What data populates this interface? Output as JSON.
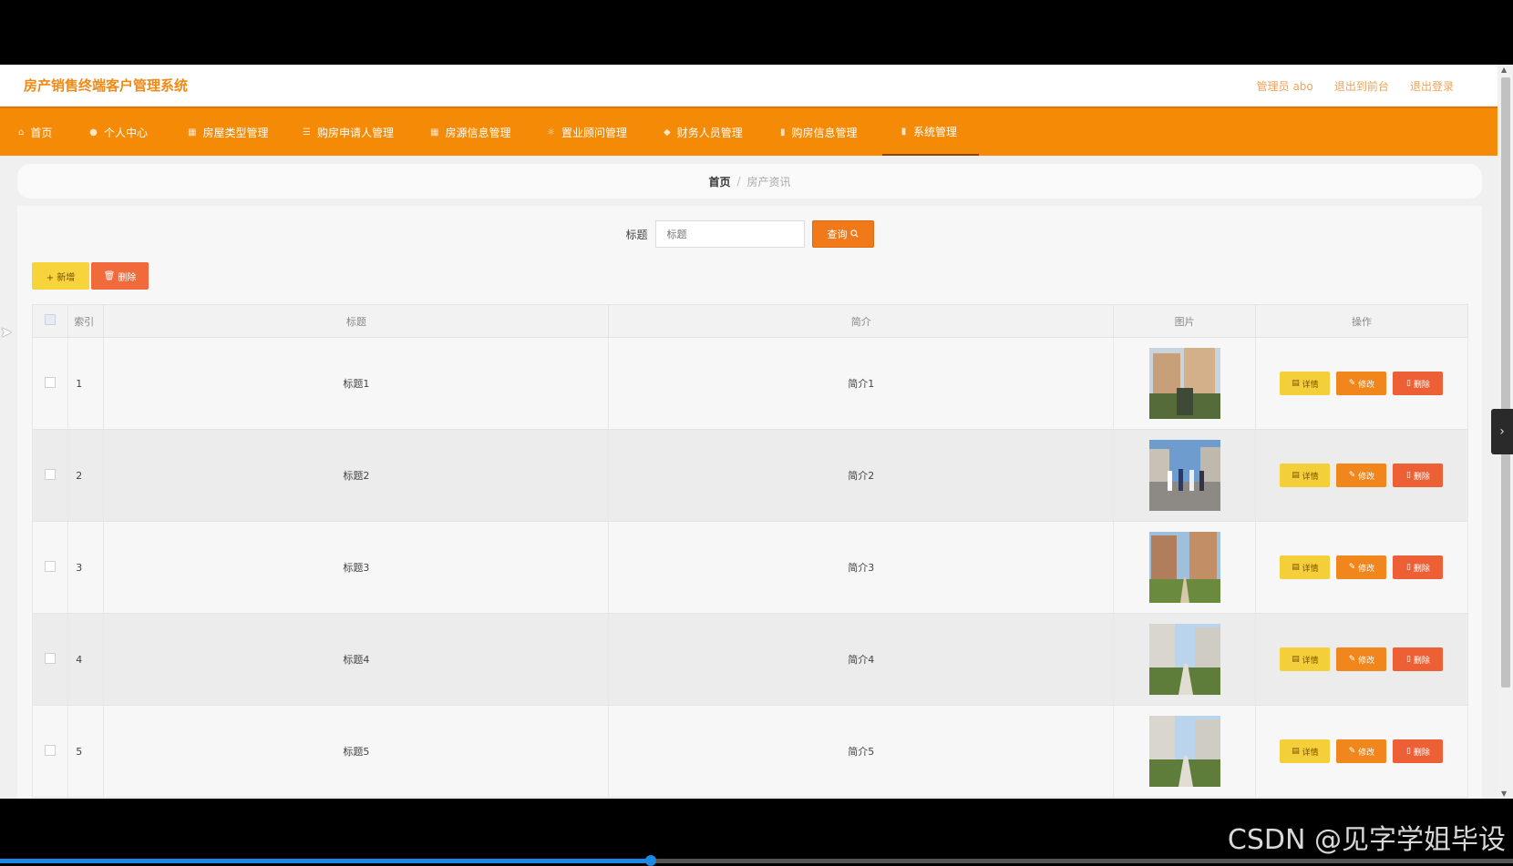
{
  "app": {
    "title": "房产销售终端客户管理系统",
    "top_links": [
      "管理员 abo",
      "退出到前台",
      "退出登录"
    ]
  },
  "nav": [
    {
      "label": "首页",
      "icon": "home-icon",
      "glyph": "⌂",
      "active": false
    },
    {
      "label": "个人中心",
      "icon": "user-icon",
      "glyph": "●",
      "active": false
    },
    {
      "label": "房屋类型管理",
      "icon": "building-icon",
      "glyph": "▦",
      "active": false
    },
    {
      "label": "购房申请人管理",
      "icon": "list-icon",
      "glyph": "☰",
      "active": false
    },
    {
      "label": "房源信息管理",
      "icon": "building-icon",
      "glyph": "▦",
      "active": false
    },
    {
      "label": "置业顾问管理",
      "icon": "sun-icon",
      "glyph": "☼",
      "active": false
    },
    {
      "label": "财务人员管理",
      "icon": "wallet-icon",
      "glyph": "◆",
      "active": false
    },
    {
      "label": "购房信息管理",
      "icon": "bar-chart-icon",
      "glyph": "▮",
      "active": false
    },
    {
      "label": "系统管理",
      "icon": "chart-icon",
      "glyph": "▮",
      "active": true
    }
  ],
  "breadcrumb": {
    "home": "首页",
    "separator": "/",
    "current": "房产资讯"
  },
  "search": {
    "label": "标题",
    "placeholder": "标题",
    "button": "查询"
  },
  "actions": {
    "add": "+ 新增",
    "delete": "删除"
  },
  "table": {
    "headers": {
      "index": "索引",
      "title": "标题",
      "intro": "简介",
      "image": "图片",
      "ops": "操作"
    },
    "op_labels": {
      "detail": "详情",
      "edit": "修改",
      "delete": "删除"
    },
    "rows": [
      {
        "index": "1",
        "title": "标题1",
        "intro": "简介1",
        "image": "residential-tower-photo"
      },
      {
        "index": "2",
        "title": "标题2",
        "intro": "简介2",
        "image": "people-walking-photo"
      },
      {
        "index": "3",
        "title": "标题3",
        "intro": "简介3",
        "image": "apartment-courtyard-photo"
      },
      {
        "index": "4",
        "title": "标题4",
        "intro": "简介4",
        "image": "garden-path-photo"
      },
      {
        "index": "5",
        "title": "标题5",
        "intro": "简介5",
        "image": "garden-path-photo"
      }
    ]
  },
  "watermark": "CSDN @见字学姐毕设",
  "video_progress": 0.43,
  "colors": {
    "primary": "#f58a06",
    "title": "#f08a16",
    "detail": "#f5cf39",
    "edit": "#f0861c",
    "delete": "#ed5f34"
  }
}
